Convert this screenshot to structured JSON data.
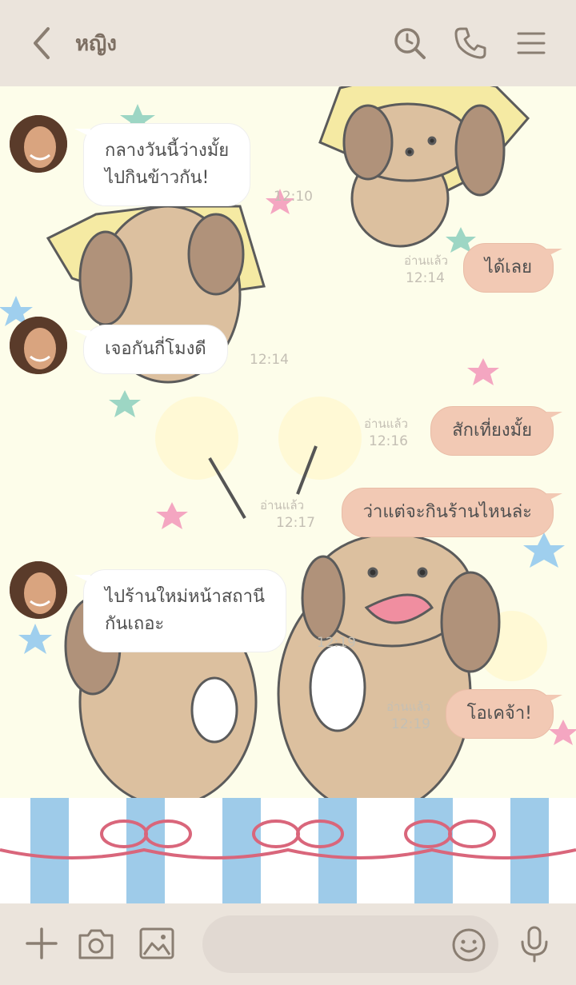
{
  "header": {
    "title": "หญิง",
    "icons": [
      "chevron-left-icon",
      "search-icon",
      "phone-icon",
      "menu-icon"
    ]
  },
  "messages": [
    {
      "side": "in",
      "lines": [
        "กลางวันนี้ว่างมั้ย",
        "ไปกินข้าวกัน!"
      ],
      "time": "12:10"
    },
    {
      "side": "out",
      "text": "ได้เลย",
      "read": "อ่านแล้ว",
      "time": "12:14"
    },
    {
      "side": "in",
      "text": "เจอกันกี่โมงดี",
      "time": "12:14"
    },
    {
      "side": "out",
      "text": "สักเที่ยงมั้ย",
      "read": "อ่านแล้ว",
      "time": "12:16"
    },
    {
      "side": "out",
      "text": "ว่าแต่จะกินร้านไหนล่ะ",
      "read": "อ่านแล้ว",
      "time": "12:17"
    },
    {
      "side": "in",
      "lines": [
        "ไปร้านใหม่หน้าสถานี",
        "กันเถอะ"
      ],
      "time": "12:19"
    },
    {
      "side": "out",
      "text": "โอเคจ้า!",
      "read": "อ่านแล้ว",
      "time": "12:19"
    }
  ],
  "footer": {
    "icons": [
      "plus-icon",
      "camera-icon",
      "image-icon",
      "emoji-icon",
      "microphone-icon"
    ],
    "input_placeholder": ""
  },
  "colors": {
    "header_bg": "#ebe4dc",
    "chat_bg": "#fdfdea",
    "bubble_out": "#f2c9b4",
    "bubble_in": "#ffffff",
    "icon": "#8a7e72",
    "stripe_blue": "#9ecbe9",
    "ribbon": "#d9667b"
  }
}
